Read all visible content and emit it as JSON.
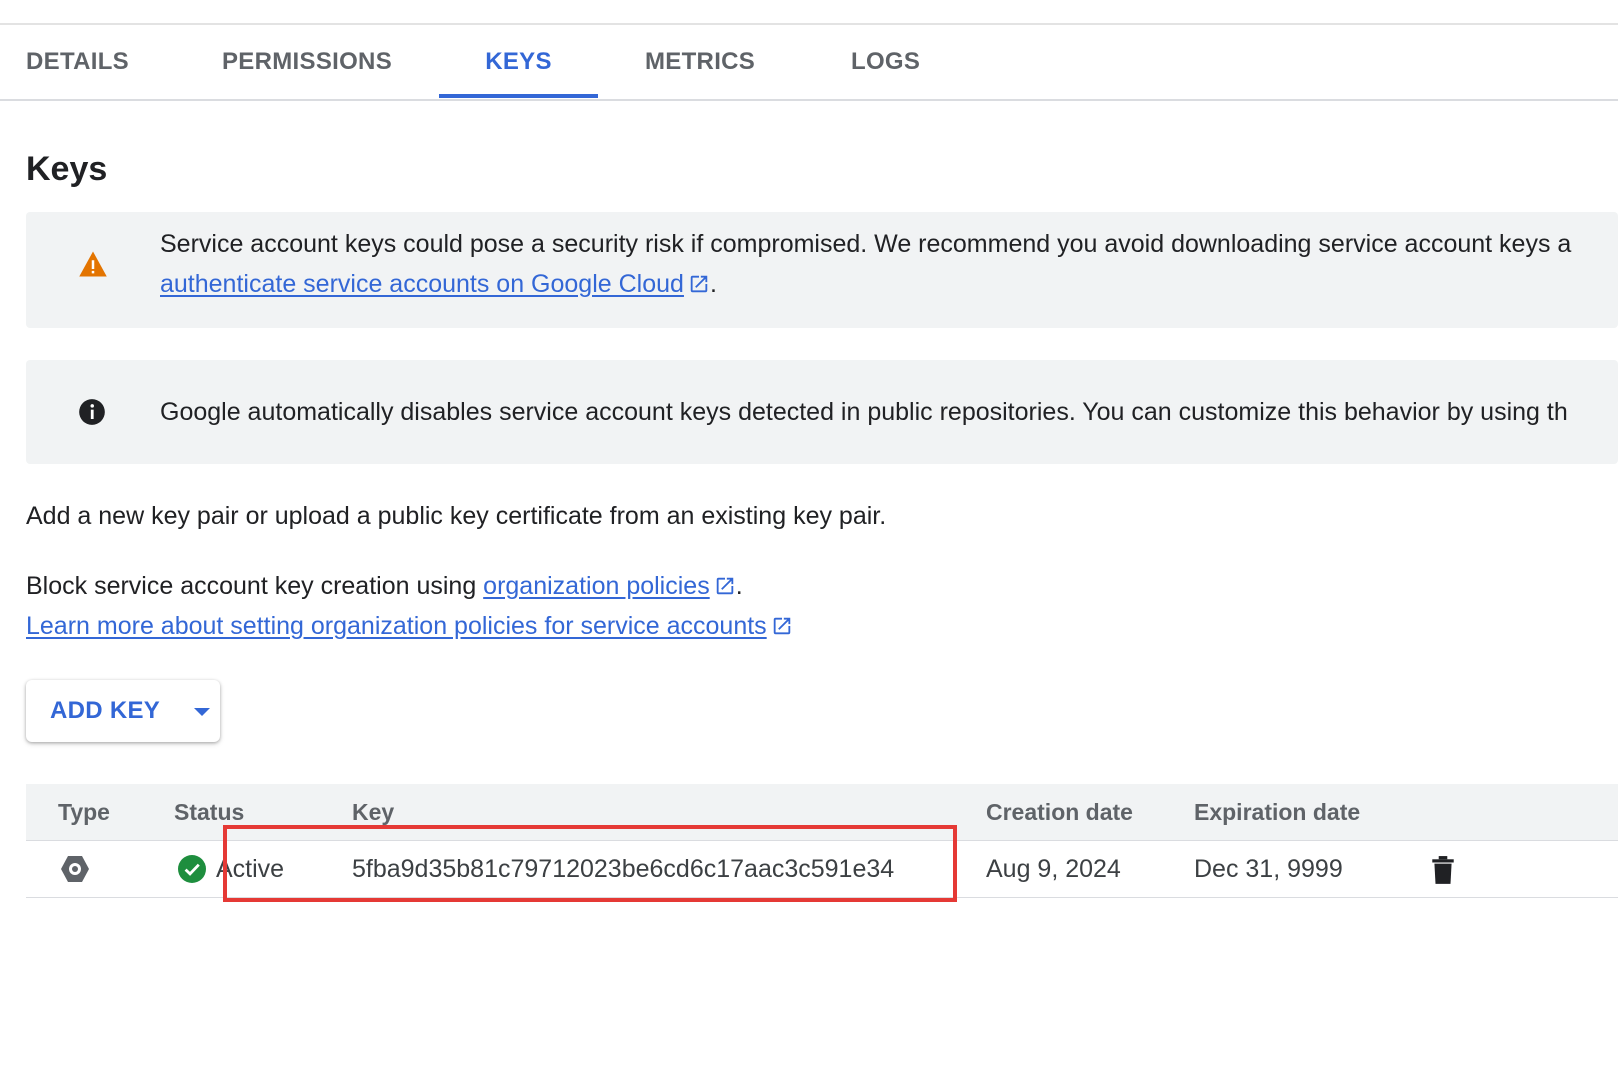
{
  "tabs": [
    {
      "label": "DETAILS"
    },
    {
      "label": "PERMISSIONS"
    },
    {
      "label": "KEYS",
      "active": true
    },
    {
      "label": "METRICS"
    },
    {
      "label": "LOGS"
    }
  ],
  "page": {
    "title": "Keys"
  },
  "warning_banner": {
    "icon": "warning-icon",
    "text": "Service account keys could pose a security risk if compromised. We recommend you avoid downloading service account keys a",
    "link_text": "authenticate service accounts on Google Cloud",
    "after_link": "."
  },
  "info_banner": {
    "icon": "info-icon",
    "text": "Google automatically disables service account keys detected in public repositories. You can customize this behavior by using th"
  },
  "intro": {
    "text": "Add a new key pair or upload a public key certificate from an existing key pair."
  },
  "policy": {
    "prefix": "Block service account key creation using ",
    "link_text": "organization policies",
    "suffix": ".",
    "learn_more": "Learn more about setting organization policies for service accounts"
  },
  "add_key_button": {
    "label": "ADD KEY"
  },
  "table": {
    "columns": [
      "Type",
      "Status",
      "Key",
      "Creation date",
      "Expiration date"
    ],
    "rows": [
      {
        "type_icon": "service-account-key-icon",
        "status": "Active",
        "key": "5fba9d35b81c79712023be6cd6c17aac3c591e34",
        "creation_date": "Aug 9, 2024",
        "expiration_date": "Dec 31, 9999",
        "action_icon": "delete-icon"
      }
    ]
  },
  "colors": {
    "accent": "#3367d6",
    "warning": "#e37400",
    "success": "#1e8e3e",
    "highlight": "#e53935"
  }
}
